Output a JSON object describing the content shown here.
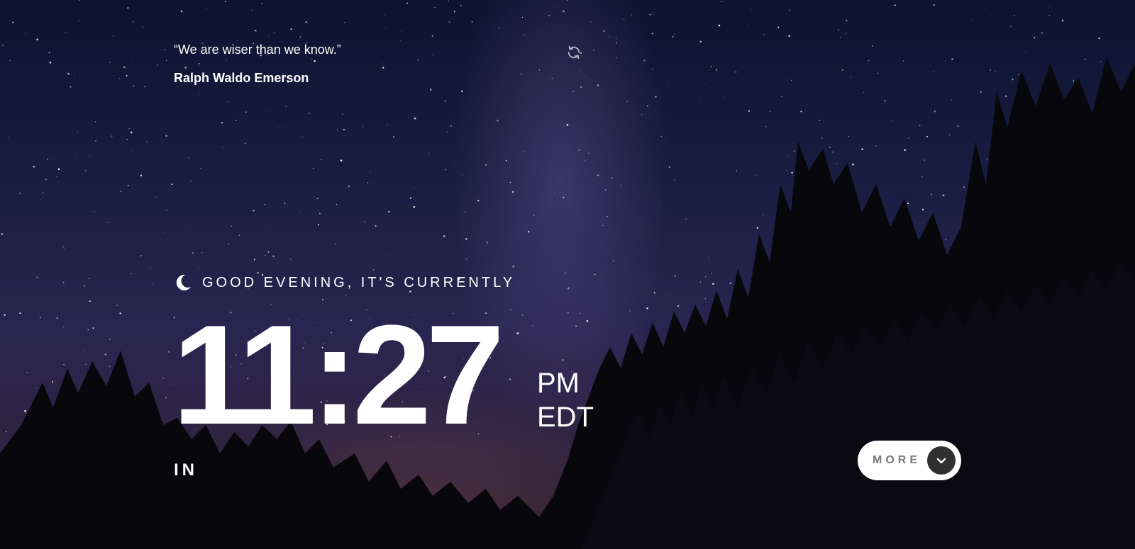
{
  "quote": {
    "text": "“We are wiser than we know.”",
    "author": "Ralph Waldo Emerson",
    "refresh_icon": "refresh-icon"
  },
  "greeting": {
    "icon": "moon-icon",
    "text": "GOOD EVENING, IT'S CURRENTLY"
  },
  "clock": {
    "time": "11:27",
    "period": "PM",
    "timezone": "EDT"
  },
  "location": {
    "text": "IN"
  },
  "more_button": {
    "label": "MORE",
    "icon": "chevron-down-icon"
  },
  "colors": {
    "text": "#ffffff",
    "button_bg": "#ffffff",
    "button_label": "#7a7a7a",
    "chevron_bg": "#303030"
  }
}
